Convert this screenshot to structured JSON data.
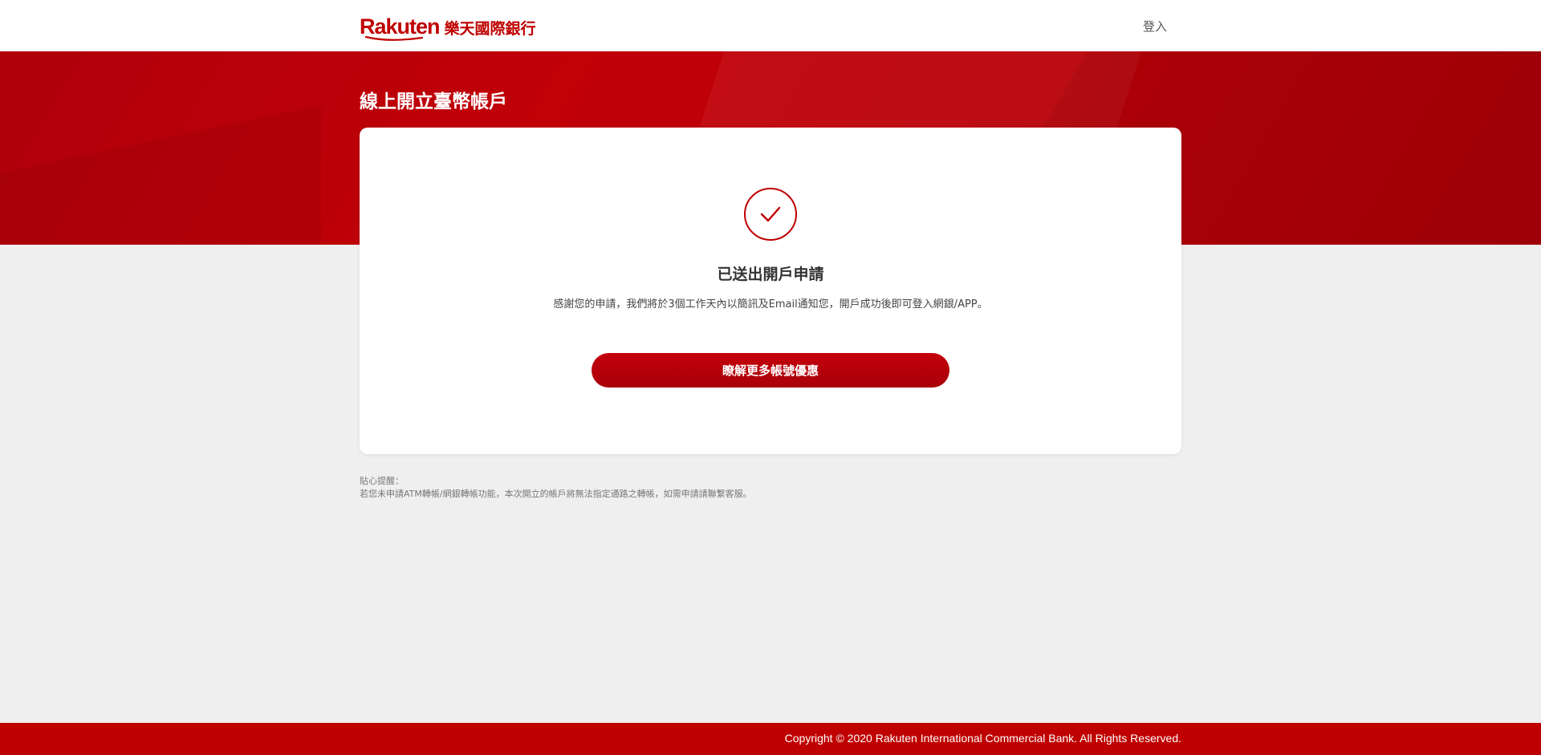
{
  "header": {
    "logo_word": "Rakuten",
    "logo_bank_name": "樂天國際銀行",
    "login_label": "登入"
  },
  "banner": {
    "title": "線上開立臺幣帳戶"
  },
  "card": {
    "status_icon": "check-icon",
    "title": "已送出開戶申請",
    "message": "感謝您的申請，我們將於3個工作天內以簡訊及Email通知您，開戶成功後即可登入網銀/APP。",
    "button_label": "瞭解更多帳號優惠"
  },
  "reminder": {
    "heading": "貼心提醒：",
    "text": "若您未申請ATM轉帳/網銀轉帳功能，本次開立的帳戶將無法指定通路之轉帳，如需申請請聯繫客服。"
  },
  "footer": {
    "copyright": "Copyright © 2020 Rakuten International Commercial Bank. All Rights Reserved."
  },
  "colors": {
    "brand_red": "#bf0000",
    "page_background": "#efefef",
    "card_background": "#ffffff"
  }
}
